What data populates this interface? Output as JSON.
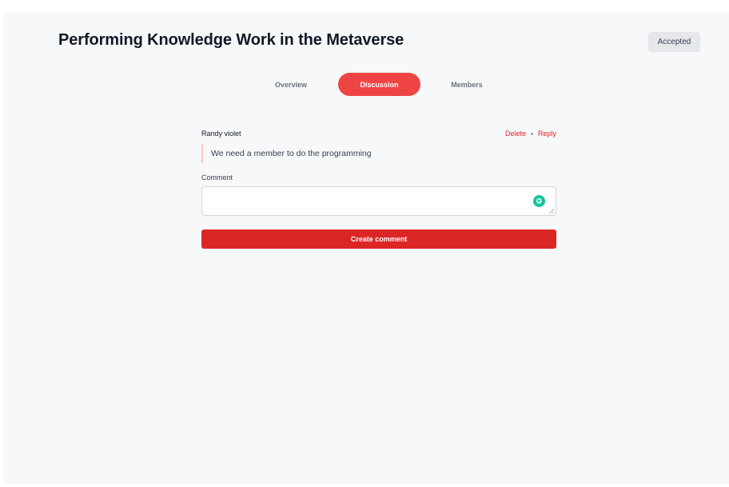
{
  "header": {
    "title": "Performing Knowledge Work in the Metaverse",
    "status": "Accepted"
  },
  "tabs": [
    {
      "label": "Overview",
      "active": false
    },
    {
      "label": "Discussion",
      "active": true
    },
    {
      "label": "Members",
      "active": false
    }
  ],
  "comments": [
    {
      "author": "Randy violet",
      "body": "We need a member to do the programming",
      "actions": {
        "delete": "Delete",
        "reply": "Reply"
      }
    }
  ],
  "form": {
    "label": "Comment",
    "value": "",
    "submit_label": "Create comment",
    "assist_icon": "grammarly-icon"
  },
  "colors": {
    "accent": "#ef4444",
    "button": "#dc2626",
    "background": "#f7f8fa",
    "badge": "#e5e7eb"
  }
}
